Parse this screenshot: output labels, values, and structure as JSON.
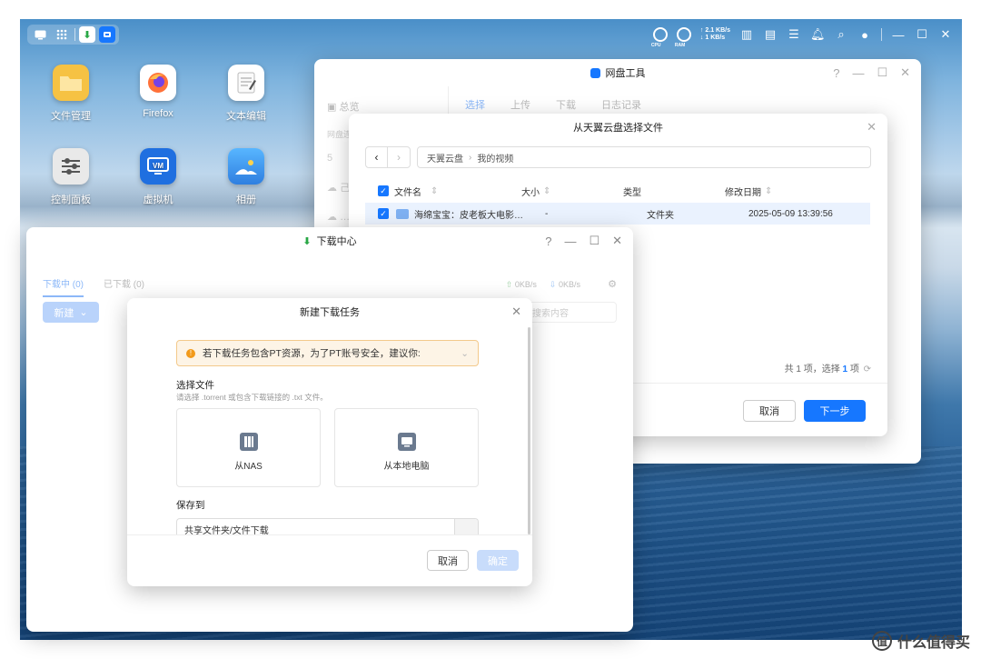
{
  "topbar": {
    "cpu_label": "CPU",
    "ram_label": "RAM",
    "net_up": "↑ 2.1 KB/s",
    "net_down": "↓ 1 KB/s"
  },
  "desktop_icons": [
    {
      "label": "文件管理",
      "icon": "folder-icon",
      "color": "#f6c243"
    },
    {
      "label": "Firefox",
      "icon": "firefox-icon",
      "color": "#ffffff"
    },
    {
      "label": "文本编辑",
      "icon": "text-editor-icon",
      "color": "#ffffff"
    },
    {
      "label": "控制面板",
      "icon": "control-panel-icon",
      "color": "#e9e9e9"
    },
    {
      "label": "虚拟机",
      "icon": "vm-icon",
      "color": "#1f6fe0"
    },
    {
      "label": "相册",
      "icon": "photos-icon",
      "color": "#3d9bf0"
    }
  ],
  "cloud_tool": {
    "title": "网盘工具",
    "sidebar": [
      "总览",
      "网盘连",
      "5",
      "己",
      "…"
    ],
    "tabs": [
      "选择",
      "上传",
      "下载",
      "日志记录"
    ]
  },
  "file_picker": {
    "title": "从天翼云盘选择文件",
    "breadcrumb": [
      "天翼云盘",
      "我的视频"
    ],
    "columns": [
      "文件名",
      "大小",
      "类型",
      "修改日期"
    ],
    "rows": [
      {
        "name": "海绵宝宝：皮老板大电影…",
        "size": "-",
        "type": "文件夹",
        "modified": "2025-05-09 13:39:56"
      }
    ],
    "summary_prefix": "共 1 项，选择",
    "summary_count": "1",
    "summary_suffix": "项",
    "cancel": "取消",
    "next": "下一步"
  },
  "download_center": {
    "title": "下载中心",
    "tab_active": "下载中 (0)",
    "tab_other": "已下载 (0)",
    "new_button": "新建",
    "upload_speed": "0KB/s",
    "download_speed": "0KB/s",
    "search_placeholder": "搜索内容"
  },
  "new_task": {
    "title": "新建下载任务",
    "warning": "若下载任务包含PT资源，为了PT账号安全，建议你:",
    "select_file_label": "选择文件",
    "select_file_hint": "请选择 .torrent 或包含下载链接的 .txt 文件。",
    "from_nas": "从NAS",
    "from_local": "从本地电脑",
    "save_to_label": "保存到",
    "save_to_value": "共享文件夹/文件下载",
    "cancel": "取消",
    "confirm": "确定"
  },
  "watermark": {
    "logo": "值",
    "text": "什么值得买"
  },
  "colors": {
    "accent": "#1677ff",
    "warning_bg": "#fdf4e6",
    "warning_border": "#f3c98b",
    "warning_icon": "#f29a1b"
  }
}
